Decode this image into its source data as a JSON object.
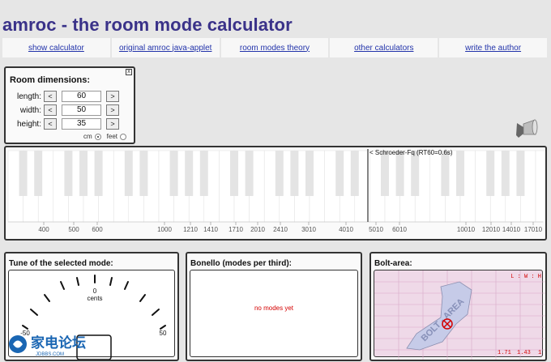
{
  "title": "amroc - the room mode calculator",
  "nav": [
    "show calculator",
    "original amroc java-applet",
    "room modes theory",
    "other calculators",
    "write the author"
  ],
  "room": {
    "title": "Room dimensions:",
    "close": "x",
    "rows": [
      {
        "label": "length:",
        "value": "60"
      },
      {
        "label": "width:",
        "value": "50"
      },
      {
        "label": "height:",
        "value": "35"
      }
    ],
    "dec": "<",
    "inc": ">",
    "unit_cm": "cm",
    "unit_feet": "feet",
    "selected_unit": "cm"
  },
  "keyboard": {
    "schroeder_label": "< Schroeder-Fq (RT60=0.6s)",
    "freq_labels": [
      "400",
      "500",
      "600",
      "1000",
      "1210",
      "1410",
      "1710",
      "2010",
      "2410",
      "3010",
      "4010",
      "5010",
      "6010",
      "10010",
      "12010",
      "14010",
      "17010"
    ]
  },
  "tune": {
    "title": "Tune of the selected mode:",
    "center_value": "0",
    "center_unit": "cents",
    "min_label": "-50",
    "max_label": "50"
  },
  "bonello": {
    "title": "Bonello (modes per third):",
    "message": "no modes yet"
  },
  "bolt": {
    "title": "Bolt-area:",
    "axis_label": "L : W : H",
    "area_label": "BOLT - AREA",
    "ratio_w": "1.71",
    "ratio_h": "1.43",
    "ratio_l": "1"
  },
  "watermark": {
    "text": "家电论坛",
    "sub": "JDBBS.COM"
  }
}
